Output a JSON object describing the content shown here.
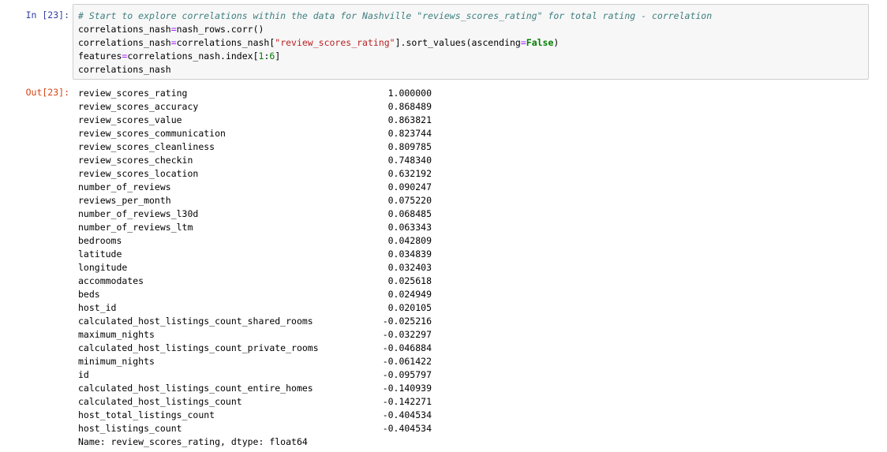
{
  "input": {
    "prompt": "In [23]:",
    "lines": [
      [
        {
          "t": "# Start to explore correlations within the data for Nashville \"reviews_scores_rating\" for total rating - correlation",
          "c": "comment"
        }
      ],
      [
        {
          "t": "correlations_nash",
          "c": ""
        },
        {
          "t": "=",
          "c": "op"
        },
        {
          "t": "nash_rows.corr()",
          "c": ""
        }
      ],
      [
        {
          "t": "correlations_nash",
          "c": ""
        },
        {
          "t": "=",
          "c": "op"
        },
        {
          "t": "correlations_nash[",
          "c": ""
        },
        {
          "t": "\"review_scores_rating\"",
          "c": "str"
        },
        {
          "t": "].sort_values(ascending",
          "c": ""
        },
        {
          "t": "=",
          "c": "op"
        },
        {
          "t": "False",
          "c": "kw"
        },
        {
          "t": ")",
          "c": ""
        }
      ],
      [
        {
          "t": "features",
          "c": ""
        },
        {
          "t": "=",
          "c": "op"
        },
        {
          "t": "correlations_nash.index[",
          "c": ""
        },
        {
          "t": "1",
          "c": "num"
        },
        {
          "t": ":",
          "c": ""
        },
        {
          "t": "6",
          "c": "num"
        },
        {
          "t": "]",
          "c": ""
        }
      ],
      [
        {
          "t": "correlations_nash",
          "c": ""
        }
      ]
    ]
  },
  "output": {
    "prompt": "Out[23]:",
    "rows": [
      {
        "name": "review_scores_rating",
        "value": "1.000000"
      },
      {
        "name": "review_scores_accuracy",
        "value": "0.868489"
      },
      {
        "name": "review_scores_value",
        "value": "0.863821"
      },
      {
        "name": "review_scores_communication",
        "value": "0.823744"
      },
      {
        "name": "review_scores_cleanliness",
        "value": "0.809785"
      },
      {
        "name": "review_scores_checkin",
        "value": "0.748340"
      },
      {
        "name": "review_scores_location",
        "value": "0.632192"
      },
      {
        "name": "number_of_reviews",
        "value": "0.090247"
      },
      {
        "name": "reviews_per_month",
        "value": "0.075220"
      },
      {
        "name": "number_of_reviews_l30d",
        "value": "0.068485"
      },
      {
        "name": "number_of_reviews_ltm",
        "value": "0.063343"
      },
      {
        "name": "bedrooms",
        "value": "0.042809"
      },
      {
        "name": "latitude",
        "value": "0.034839"
      },
      {
        "name": "longitude",
        "value": "0.032403"
      },
      {
        "name": "accommodates",
        "value": "0.025618"
      },
      {
        "name": "beds",
        "value": "0.024949"
      },
      {
        "name": "host_id",
        "value": "0.020105"
      },
      {
        "name": "calculated_host_listings_count_shared_rooms",
        "value": "-0.025216"
      },
      {
        "name": "maximum_nights",
        "value": "-0.032297"
      },
      {
        "name": "calculated_host_listings_count_private_rooms",
        "value": "-0.046884"
      },
      {
        "name": "minimum_nights",
        "value": "-0.061422"
      },
      {
        "name": "id",
        "value": "-0.095797"
      },
      {
        "name": "calculated_host_listings_count_entire_homes",
        "value": "-0.140939"
      },
      {
        "name": "calculated_host_listings_count",
        "value": "-0.142271"
      },
      {
        "name": "host_total_listings_count",
        "value": "-0.404534"
      },
      {
        "name": "host_listings_count",
        "value": "-0.404534"
      }
    ],
    "footer": "Name: review_scores_rating, dtype: float64"
  }
}
